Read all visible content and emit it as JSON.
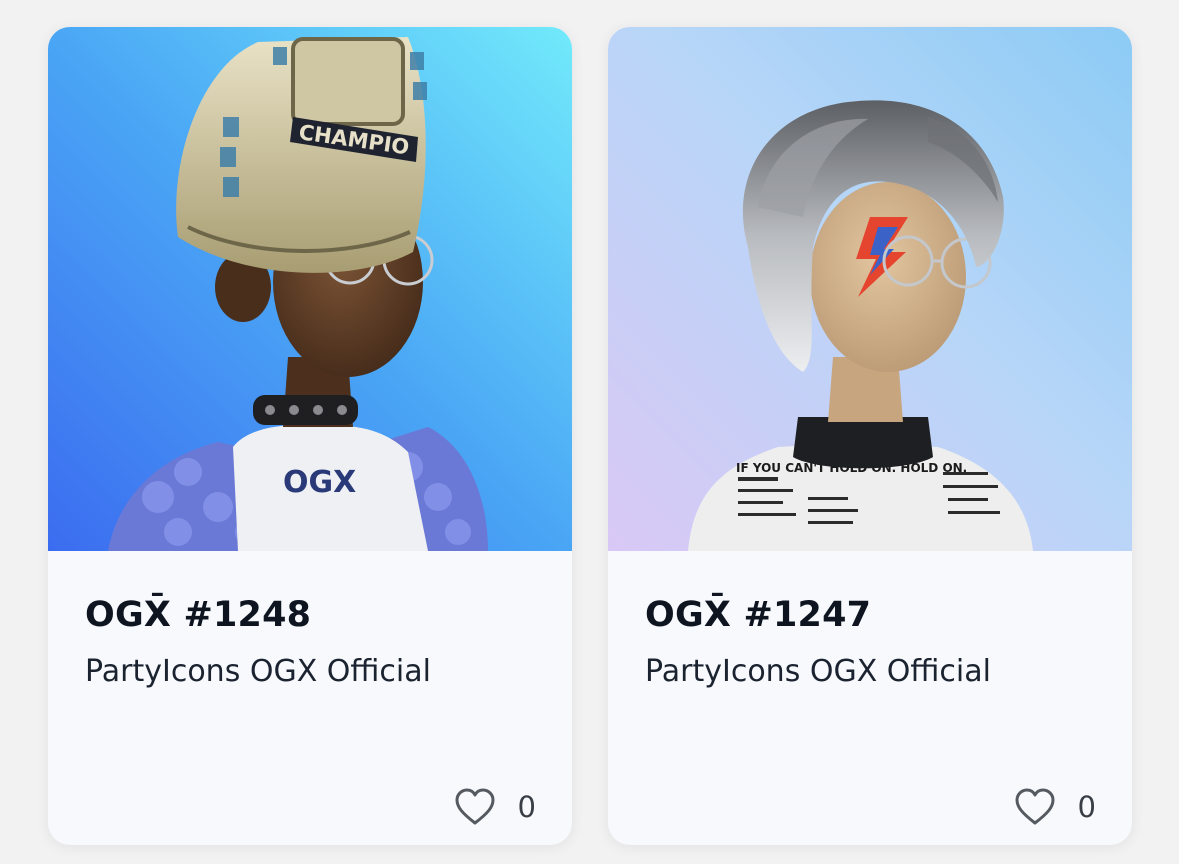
{
  "cards": [
    {
      "title": "OGX̄ #1248",
      "collection": "PartyIcons OGX Official",
      "likes": "0",
      "image_label": "CHAMPIO",
      "icon": "heart-outline-icon"
    },
    {
      "title": "OGX̄ #1247",
      "collection": "PartyIcons OGX Official",
      "likes": "0",
      "image_label": "IF YOU CAN'T HOLD ON. HOLD ON.",
      "icon": "heart-outline-icon"
    }
  ],
  "colors": {
    "page_bg": "#f2f2f3",
    "card_bg": "#f7f9fc",
    "title": "#0e1521",
    "heart_stroke": "#555a60"
  }
}
